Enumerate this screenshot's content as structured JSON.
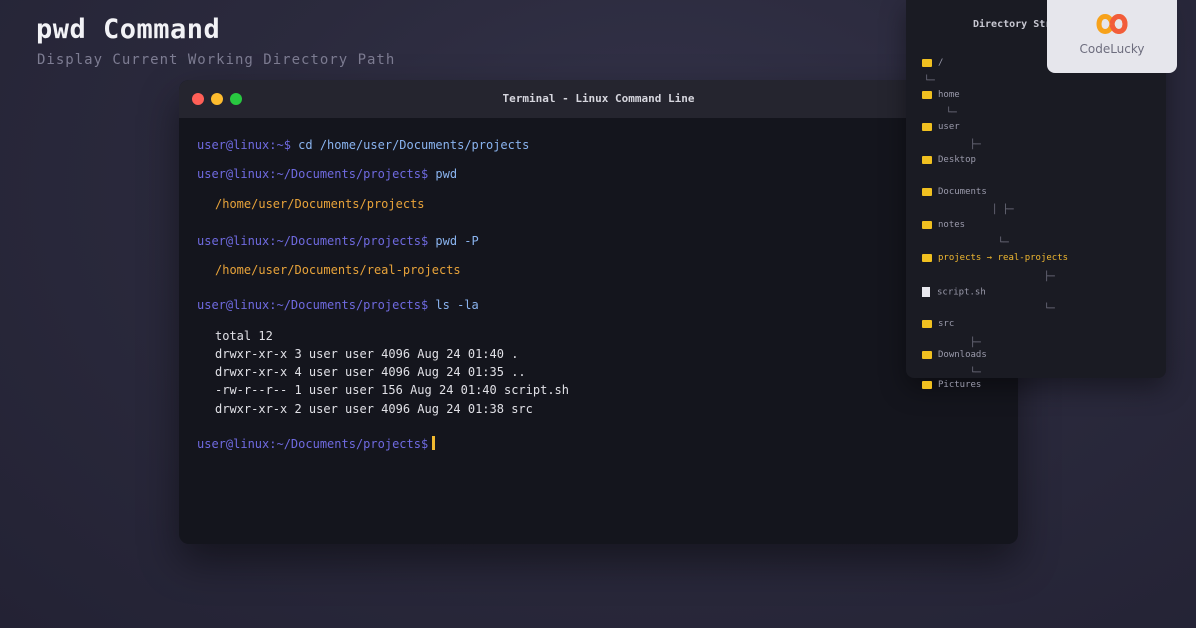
{
  "header": {
    "title": "pwd Command",
    "subtitle": "Display Current Working Directory Path"
  },
  "terminal": {
    "title": "Terminal - Linux Command Line",
    "lines": [
      {
        "prompt": "user@linux:~$",
        "cmd": " cd /home/user/Documents/projects"
      },
      {
        "prompt": "user@linux:~/Documents/projects$",
        "cmd": " pwd"
      },
      {
        "output": "/home/user/Documents/projects",
        "kind": "path"
      },
      {
        "prompt": "user@linux:~/Documents/projects$",
        "cmd": " pwd -P"
      },
      {
        "output": "/home/user/Documents/real-projects",
        "kind": "path"
      },
      {
        "prompt": "user@linux:~/Documents/projects$",
        "cmd": " ls -la"
      },
      {
        "output": "total 12",
        "kind": "text"
      },
      {
        "output": "drwxr-xr-x 3 user user 4096 Aug 24 01:40 .",
        "kind": "text"
      },
      {
        "output": "drwxr-xr-x 4 user user 4096 Aug 24 01:35 ..",
        "kind": "text"
      },
      {
        "output": "-rw-r--r-- 1 user user 156 Aug 24 01:40 script.sh",
        "kind": "text"
      },
      {
        "output": "drwxr-xr-x 2 user user 4096 Aug 24 01:38 src",
        "kind": "text"
      },
      {
        "prompt": "user@linux:~/Documents/projects$",
        "cmd": ""
      }
    ]
  },
  "tree": {
    "title": "Directory Structure",
    "nodes": [
      {
        "label": "/",
        "type": "folder"
      },
      {
        "label": "home",
        "type": "folder"
      },
      {
        "label": "user",
        "type": "folder"
      },
      {
        "label": "Desktop",
        "type": "folder"
      },
      {
        "label": "Documents",
        "type": "folder"
      },
      {
        "label": "notes",
        "type": "folder"
      },
      {
        "label": "projects → real-projects",
        "type": "folder",
        "highlight": true
      },
      {
        "label": "script.sh",
        "type": "file"
      },
      {
        "label": "src",
        "type": "folder"
      },
      {
        "label": "Downloads",
        "type": "folder"
      },
      {
        "label": "Pictures",
        "type": "folder"
      }
    ]
  },
  "logo": {
    "text": "CodeLucky",
    "icon": "codelucky-infinity-logo",
    "colors": [
      "#f25c3b",
      "#f7a21b"
    ]
  },
  "colors": {
    "prompt": "#6f6ae0",
    "command": "#8ab4f0",
    "path_output": "#e8a33a",
    "folder": "#f0c020"
  }
}
